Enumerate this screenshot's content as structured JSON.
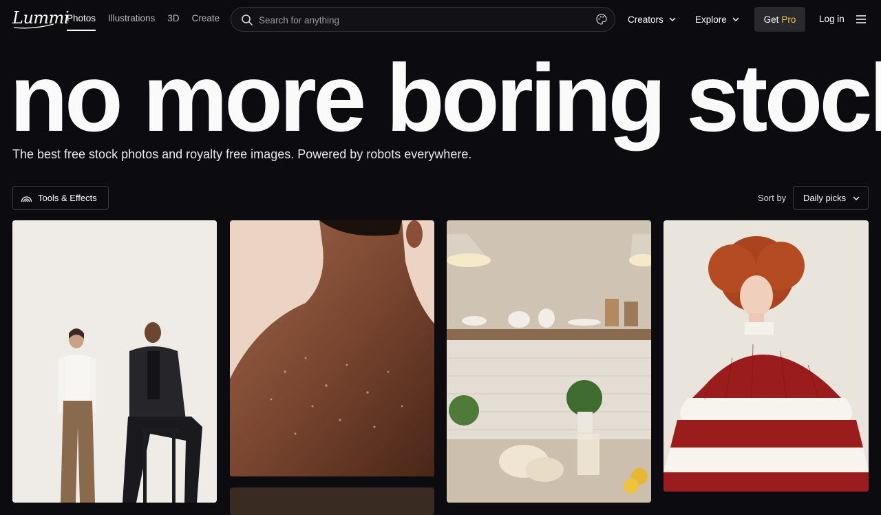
{
  "nav": {
    "logo": "Lummi",
    "links": [
      "Photos",
      "Illustrations",
      "3D",
      "Create"
    ],
    "search_placeholder": "Search for anything",
    "creators_label": "Creators",
    "explore_label": "Explore",
    "get_label": "Get",
    "pro_label": "Pro",
    "login_label": "Log in"
  },
  "hero": {
    "title": "no more boring stock",
    "subtitle": "The best free stock photos and royalty free images. Powered by robots everywhere."
  },
  "toolbar": {
    "tools_label": "Tools & Effects",
    "sort_label": "Sort by",
    "sort_value": "Daily picks"
  },
  "colors": {
    "background": "#0c0b0f",
    "pro_accent": "#f4c542"
  }
}
